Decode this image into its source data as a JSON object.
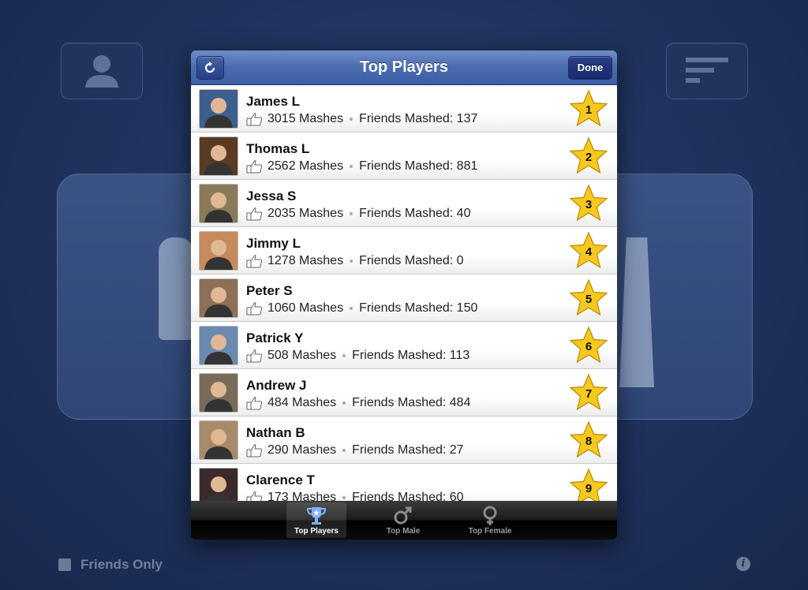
{
  "background": {
    "friends_only_label": "Friends Only",
    "info_icon": "i"
  },
  "popover": {
    "title": "Top Players",
    "done_label": "Done",
    "players": [
      {
        "name": "James L",
        "mashes": "3015 Mashes",
        "friends": "Friends Mashed: 137",
        "rank": "1",
        "avatar_color": "#3d5f8f"
      },
      {
        "name": "Thomas L",
        "mashes": "2562 Mashes",
        "friends": "Friends Mashed: 881",
        "rank": "2",
        "avatar_color": "#5a3a22"
      },
      {
        "name": "Jessa S",
        "mashes": "2035 Mashes",
        "friends": "Friends Mashed: 40",
        "rank": "3",
        "avatar_color": "#8a7a5a"
      },
      {
        "name": "Jimmy L",
        "mashes": "1278 Mashes",
        "friends": "Friends Mashed: 0",
        "rank": "4",
        "avatar_color": "#c78a5a"
      },
      {
        "name": "Peter S",
        "mashes": "1060 Mashes",
        "friends": "Friends Mashed: 150",
        "rank": "5",
        "avatar_color": "#8c7058"
      },
      {
        "name": "Patrick Y",
        "mashes": "508 Mashes",
        "friends": "Friends Mashed: 113",
        "rank": "6",
        "avatar_color": "#6a8ab0"
      },
      {
        "name": "Andrew J",
        "mashes": "484 Mashes",
        "friends": "Friends Mashed: 484",
        "rank": "7",
        "avatar_color": "#7a6a5a"
      },
      {
        "name": "Nathan B",
        "mashes": "290 Mashes",
        "friends": "Friends Mashed: 27",
        "rank": "8",
        "avatar_color": "#a88a6a"
      },
      {
        "name": "Clarence T",
        "mashes": "173 Mashes",
        "friends": "Friends Mashed: 60",
        "rank": "9",
        "avatar_color": "#3a2a2a"
      }
    ],
    "tabs": [
      {
        "label": "Top Players",
        "icon": "trophy-icon",
        "active": true
      },
      {
        "label": "Top Male",
        "icon": "male-symbol-icon",
        "active": false
      },
      {
        "label": "Top Female",
        "icon": "female-symbol-icon",
        "active": false
      }
    ]
  },
  "colors": {
    "nav_blue": "#4a6cb0",
    "star_yellow": "#f7c81e",
    "background_blue": "#213561"
  }
}
